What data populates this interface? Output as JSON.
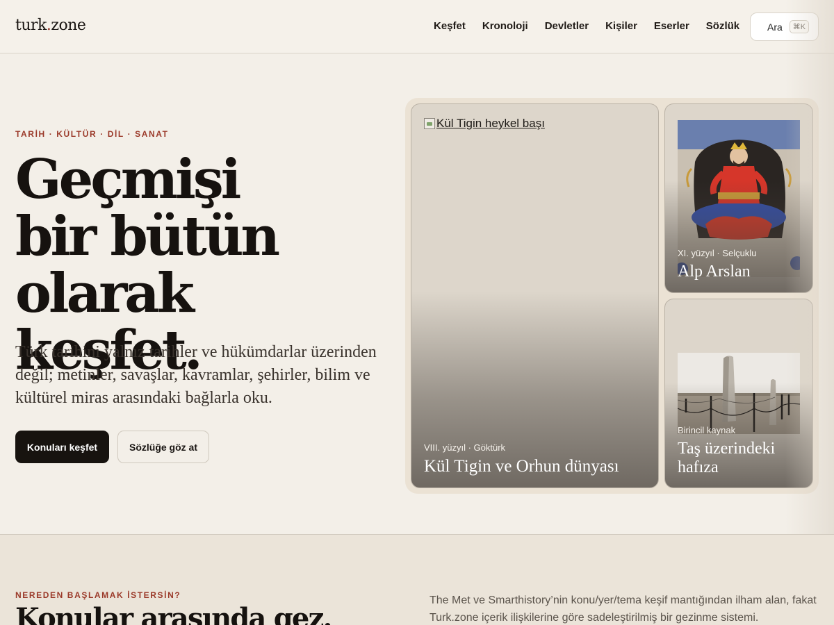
{
  "header": {
    "logo_main": "turk",
    "logo_dot": ".",
    "logo_end": "zone",
    "nav": [
      "Keşfet",
      "Kronoloji",
      "Devletler",
      "Kişiler",
      "Eserler",
      "Sözlük"
    ],
    "search_label": "Ara",
    "search_shortcut": "⌘K"
  },
  "hero": {
    "eyebrow": "TARİH · KÜLTÜR · DİL · SANAT",
    "title_lines": [
      "Geçmişi",
      "bir bütün",
      "olarak keşfet."
    ],
    "subtitle": "Türk tarihini yalnız tarihler ve hükümdarlar üzerinden değil; metinler, savaşlar, kavramlar, şehirler, bilim ve kültürel miras arasındaki bağlarla oku.",
    "primary_button": "Konuları keşfet",
    "secondary_button": "Sözlüğe göz at"
  },
  "cards": {
    "main": {
      "image_alt": "Kül Tigin heykel başı",
      "meta": "VIII. yüzyıl · Göktürk",
      "title": "Kül Tigin ve Orhun dünyası"
    },
    "top": {
      "meta": "XI. yüzyıl · Selçuklu",
      "title": "Alp Arslan"
    },
    "bottom": {
      "meta": "Birincil kaynak",
      "title": "Taş üzerindeki hafıza"
    }
  },
  "lower": {
    "eyebrow": "NEREDEN BAŞLAMAK İSTERSİN?",
    "title": "Konular arasında gez.",
    "description": "The Met ve Smarthistory’nin konu/yer/tema keşif mantığından ilham alan, fakat Turk.zone içerik ilişkilerine göre sadeleştirilmiş bir gezinme sistemi."
  },
  "colors": {
    "accent": "#9b3a2a",
    "background": "#f3efe8",
    "ink": "#16120f"
  }
}
